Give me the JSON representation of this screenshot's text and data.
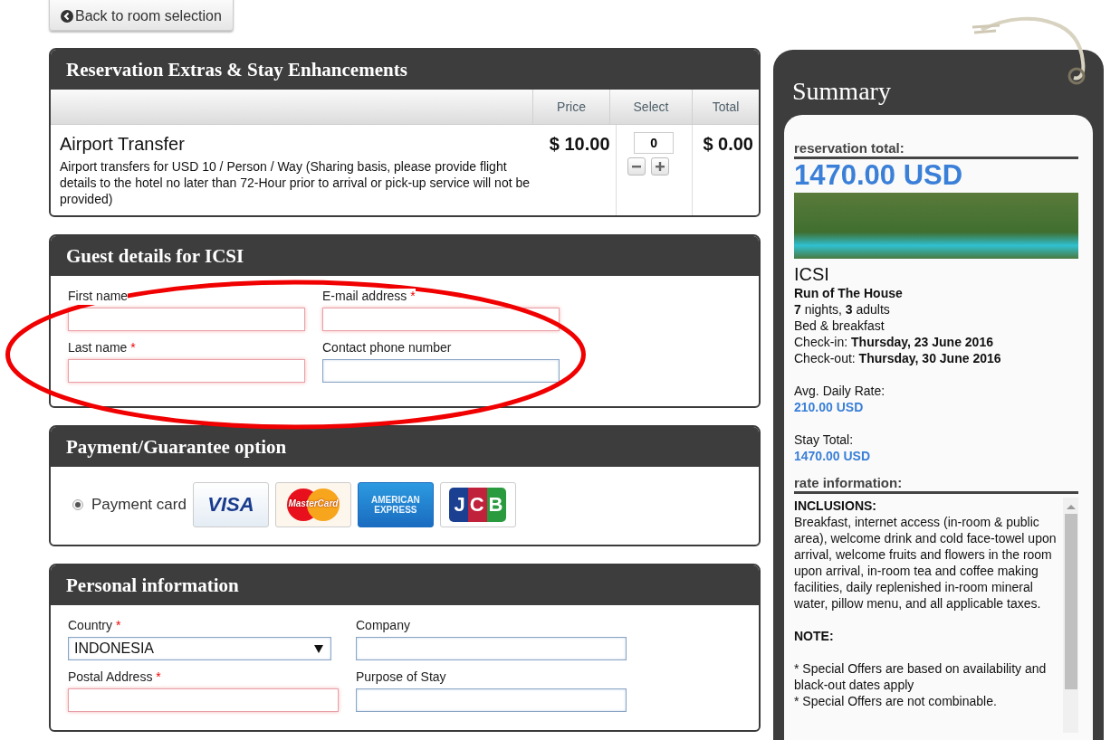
{
  "back_button": {
    "label": "Back to room selection"
  },
  "extras": {
    "title": "Reservation Extras & Stay Enhancements",
    "columns": [
      "Price",
      "Select",
      "Total"
    ],
    "items": [
      {
        "name": "Airport Transfer",
        "description": "Airport transfers for USD 10 / Person / Way (Sharing basis, please provide flight details to the hotel no later than 72-Hour prior to arrival or pick-up service will not be provided)",
        "price": "$ 10.00",
        "quantity": "0",
        "total": "$ 0.00"
      }
    ]
  },
  "guest_details": {
    "title": "Guest details for ICSI",
    "fields": [
      {
        "kind": "text",
        "label": "First name",
        "invalid": true
      },
      {
        "kind": "text",
        "label": "E-mail address",
        "required_mark": "*",
        "invalid": true
      },
      {
        "kind": "text",
        "label": "Last name",
        "required_mark": "*",
        "invalid": true
      },
      {
        "kind": "text",
        "label": "Contact phone number",
        "invalid": false
      }
    ]
  },
  "payment": {
    "title": "Payment/Guarantee option",
    "options": [
      {
        "label": "Payment card",
        "selected": true
      }
    ],
    "cards": [
      {
        "kind": "visa",
        "text": "VISA"
      },
      {
        "kind": "mastercard",
        "text": "MasterCard"
      },
      {
        "kind": "amex",
        "text": "AMERICAN EXPRESS"
      },
      {
        "kind": "jcb",
        "text": "JCB"
      }
    ]
  },
  "personal_info": {
    "title": "Personal information",
    "fields": [
      {
        "kind": "select",
        "label": "Country",
        "required_mark": "*",
        "value": "INDONESIA",
        "invalid": false
      },
      {
        "kind": "text",
        "label": "Company",
        "invalid": false
      },
      {
        "kind": "text",
        "label": "Postal Address",
        "required_mark": "*",
        "invalid": true
      },
      {
        "kind": "text",
        "label": "Purpose of Stay",
        "invalid": false
      }
    ]
  },
  "summary": {
    "title": "Summary",
    "total_label": "reservation total:",
    "total": "1470.00 USD",
    "hotel": "ICSI",
    "room": "Run of The House",
    "details": [
      "**7** nights, **3** adults",
      "Bed & breakfast",
      "Check-in: **Thursday, 23 June 2016**",
      "Check-out: **Thursday, 30 June 2016**"
    ],
    "rates": [
      {
        "label": "Avg. Daily Rate:",
        "value": "210.00 USD"
      },
      {
        "label": "Stay Total:",
        "value": "1470.00 USD"
      }
    ],
    "rate_info_label": "rate information:",
    "rate_info": [
      {
        "kind": "heading",
        "text": "INCLUSIONS:"
      },
      {
        "kind": "text",
        "text": "Breakfast, internet access (in-room & public area), welcome drink and cold face-towel upon arrival, welcome fruits and flowers in the room upon arrival, in-room tea and coffee making facilities, daily replenished in-room mineral water, pillow menu, and all applicable taxes."
      },
      {
        "kind": "heading",
        "text": "NOTE:"
      },
      {
        "kind": "text",
        "text": "* Special Offers are based on availability and black-out dates apply"
      },
      {
        "kind": "text",
        "text": "* Special Offers are not combinable."
      }
    ]
  }
}
